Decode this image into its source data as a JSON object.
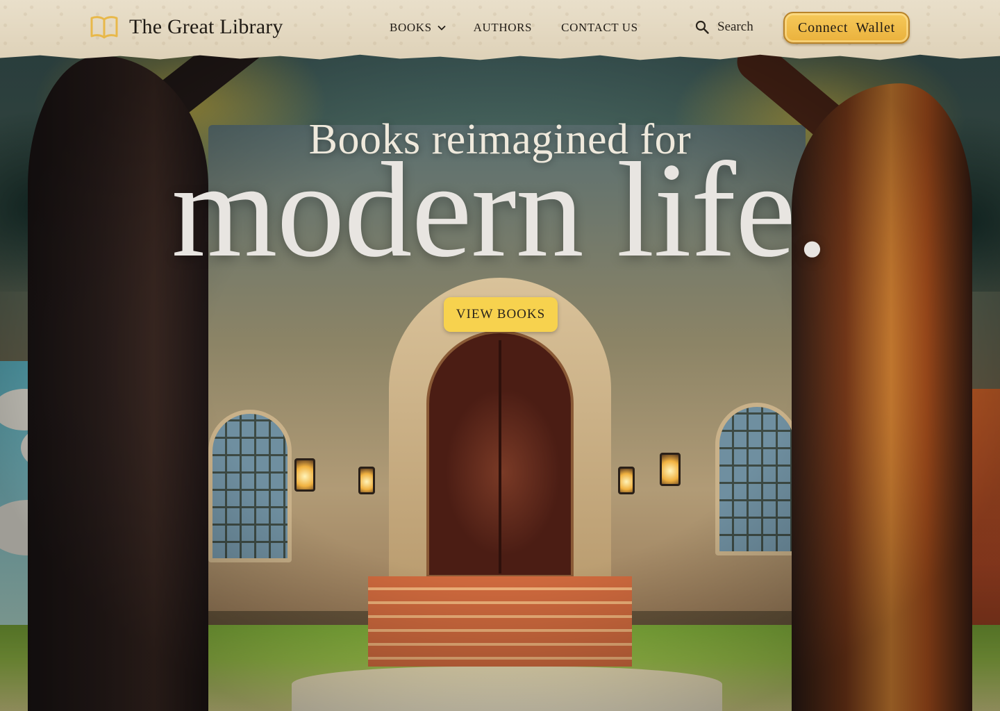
{
  "header": {
    "brand": {
      "name": "The Great Library",
      "icon": "open-book-icon"
    },
    "nav": [
      {
        "label": "BOOKS",
        "has_dropdown": true
      },
      {
        "label": "AUTHORS",
        "has_dropdown": false
      },
      {
        "label": "CONTACT US",
        "has_dropdown": false
      }
    ],
    "search": {
      "label": "Search",
      "icon": "search-icon"
    },
    "wallet_button": "Connect  Wallet"
  },
  "hero": {
    "subtitle": "Books reimagined for",
    "title": "modern life.",
    "cta": "VIEW BOOKS",
    "background": "illustration of a library building with arched door behind two large trees"
  },
  "colors": {
    "header_paper": "#e3d7bf",
    "accent_gold": "#f7d24e",
    "wallet_gold": "#eab13c",
    "brand_icon": "#e8b84a",
    "text_dark": "#1f1a14",
    "hero_text": "#e8e5e1"
  }
}
